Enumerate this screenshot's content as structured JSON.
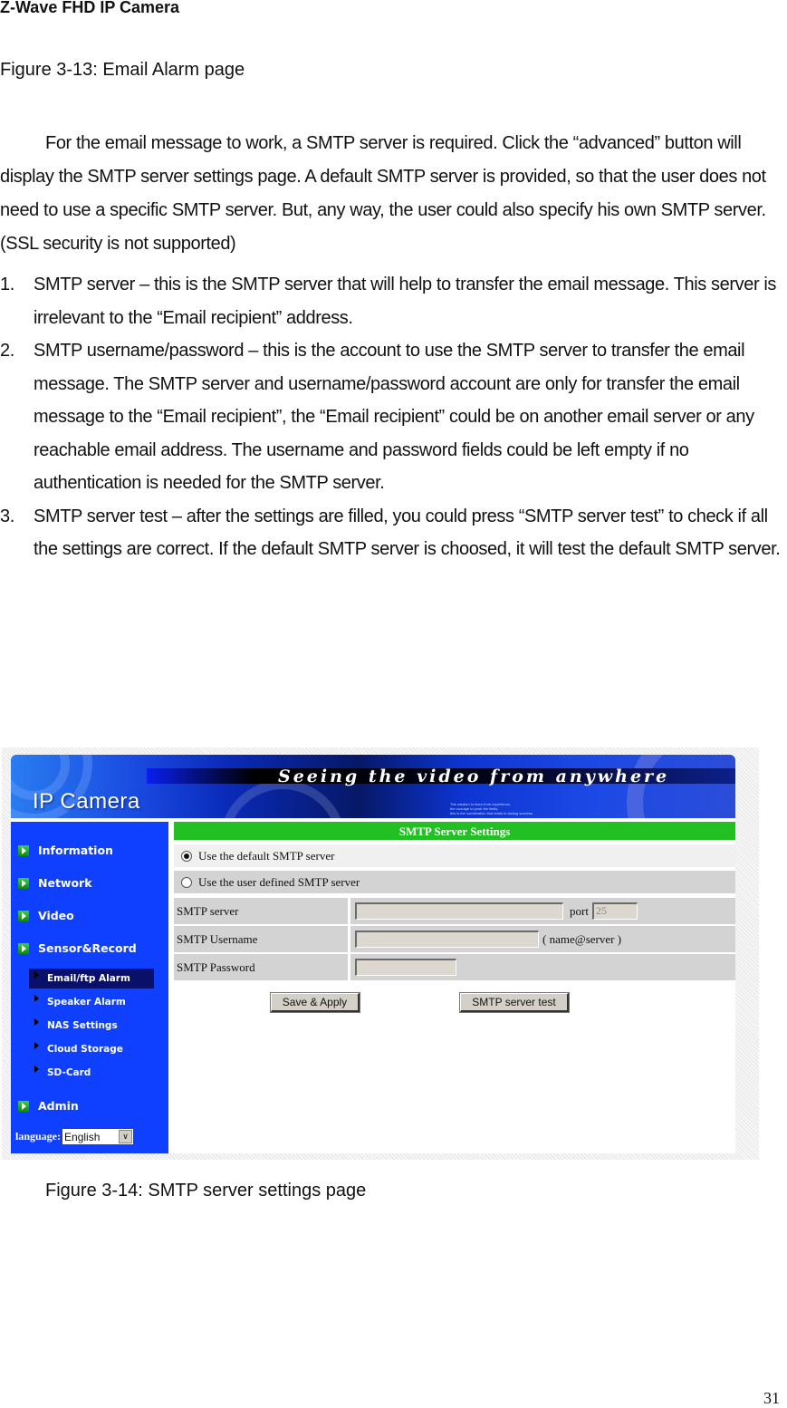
{
  "document": {
    "header": "Z-Wave FHD IP Camera",
    "figure_13_caption": "Figure 3-13: Email Alarm page",
    "intro_paragraph": "For the email message to work, a SMTP server is required. Click the “advanced” button will display the SMTP server settings page. A default SMTP server is provided, so that the user does not need to use a specific SMTP server. But, any way, the user could also specify his own SMTP server. (SSL security is not supported)",
    "list": [
      {
        "num": "1.",
        "text": "SMTP server – this is the SMTP server that will help to transfer the email message. This server is irrelevant to the “Email recipient” address."
      },
      {
        "num": "2.",
        "text": "SMTP username/password – this is the account to use the SMTP server to transfer the email message. The SMTP server and username/password account are only for transfer the email message to the “Email recipient”, the “Email recipient” could be on another email server or any reachable email address. The username and password fields could be left empty if no authentication is needed for the SMTP server."
      },
      {
        "num": "3.",
        "text": "SMTP server test – after the settings are filled, you could press “SMTP server test” to check if all the settings are correct. If the default SMTP server is choosed, it will test the default SMTP server."
      }
    ],
    "figure_14_caption": "Figure 3-14: SMTP server settings page",
    "page_number": "31"
  },
  "camera_ui": {
    "banner": {
      "logo": "IP Camera",
      "slogan": "Seeing the video from anywhere",
      "small_text": [
        "The wisdom to learn from experience,",
        "the courage to push the limits,",
        "this is the combination that leads to lasting success."
      ]
    },
    "sidebar": {
      "menu": [
        {
          "label": "Information",
          "icon": "green-arrow-icon"
        },
        {
          "label": "Network",
          "icon": "green-arrow-icon"
        },
        {
          "label": "Video",
          "icon": "green-arrow-icon"
        },
        {
          "label": "Sensor&Record",
          "icon": "green-arrow-icon"
        }
      ],
      "submenu": [
        {
          "label": "Email/ftp Alarm",
          "active": true
        },
        {
          "label": "Speaker Alarm"
        },
        {
          "label": "NAS Settings"
        },
        {
          "label": "Cloud Storage"
        },
        {
          "label": "SD-Card"
        }
      ],
      "admin": {
        "label": "Admin",
        "icon": "green-arrow-icon"
      },
      "language_label": "language:",
      "language_value": "English"
    },
    "smtp": {
      "title": "SMTP Server Settings",
      "option_default": "Use the default SMTP server",
      "option_user": "Use the user defined SMTP server",
      "selected_option": "default",
      "server_label": "SMTP server",
      "server_value": "",
      "port_label": "port",
      "port_value": "25",
      "username_label": "SMTP Username",
      "username_value": "",
      "username_hint": "( name@server )",
      "password_label": "SMTP Password",
      "password_value": "",
      "save_button": "Save & Apply",
      "test_button": "SMTP server test"
    },
    "colors": {
      "sidebar_blue": "#1040ff",
      "title_green": "#22c022",
      "active_sub_bg": "#08106a"
    }
  }
}
